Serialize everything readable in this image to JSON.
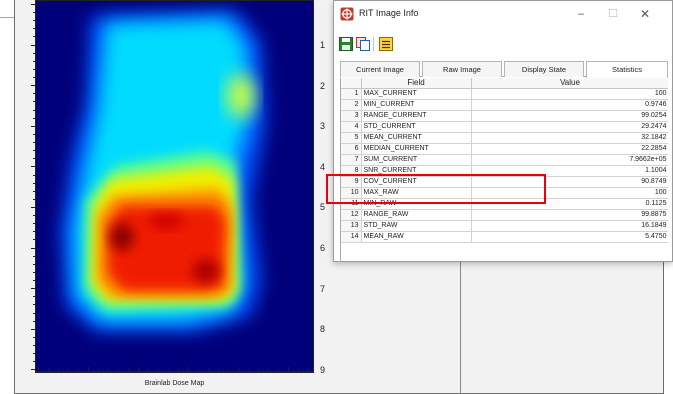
{
  "window": {
    "title": "RIT Image Info"
  },
  "window_controls": {
    "minimize": "–",
    "maximize": "☐",
    "close": "✕"
  },
  "tabs": [
    {
      "label": "Current Image",
      "active": false
    },
    {
      "label": "Raw Image",
      "active": false
    },
    {
      "label": "Display State",
      "active": false
    },
    {
      "label": "Statistics",
      "active": true
    }
  ],
  "grid": {
    "columns": [
      "",
      "Field",
      "Value"
    ],
    "rows": [
      {
        "num": "1",
        "field": "MAX_CURRENT",
        "value": "100"
      },
      {
        "num": "2",
        "field": "MIN_CURRENT",
        "value": "0.9746"
      },
      {
        "num": "3",
        "field": "RANGE_CURRENT",
        "value": "99.0254"
      },
      {
        "num": "4",
        "field": "STD_CURRENT",
        "value": "29.2474"
      },
      {
        "num": "5",
        "field": "MEAN_CURRENT",
        "value": "32.1842"
      },
      {
        "num": "6",
        "field": "MEDIAN_CURRENT",
        "value": "22.2854"
      },
      {
        "num": "7",
        "field": "SUM_CURRENT",
        "value": "7.9662e+05"
      },
      {
        "num": "8",
        "field": "SNR_CURRENT",
        "value": "1.1004"
      },
      {
        "num": "9",
        "field": "COV_CURRENT",
        "value": "90.8749"
      },
      {
        "num": "10",
        "field": "MAX_RAW",
        "value": "100"
      },
      {
        "num": "11",
        "field": "MIN_RAW",
        "value": "0.1125"
      },
      {
        "num": "12",
        "field": "RANGE_RAW",
        "value": "99.8875"
      },
      {
        "num": "13",
        "field": "STD_RAW",
        "value": "16.1849"
      },
      {
        "num": "14",
        "field": "MEAN_RAW",
        "value": "5.4750"
      }
    ],
    "highlighted_rows": [
      "8",
      "9"
    ],
    "highlight_color": "#e8000d"
  },
  "plot": {
    "caption": "Brainlab Dose Map",
    "y_tick_labels": [
      "1",
      "2",
      "3",
      "4",
      "5",
      "6",
      "7",
      "8",
      "9"
    ],
    "colormap": "jet",
    "background_color": "#00007a"
  },
  "toolbar": {
    "icons": [
      "save-icon",
      "copy-icon",
      "properties-icon"
    ]
  },
  "app_icon": "rit-logo-icon",
  "app_icon_color": "#c0392b"
}
